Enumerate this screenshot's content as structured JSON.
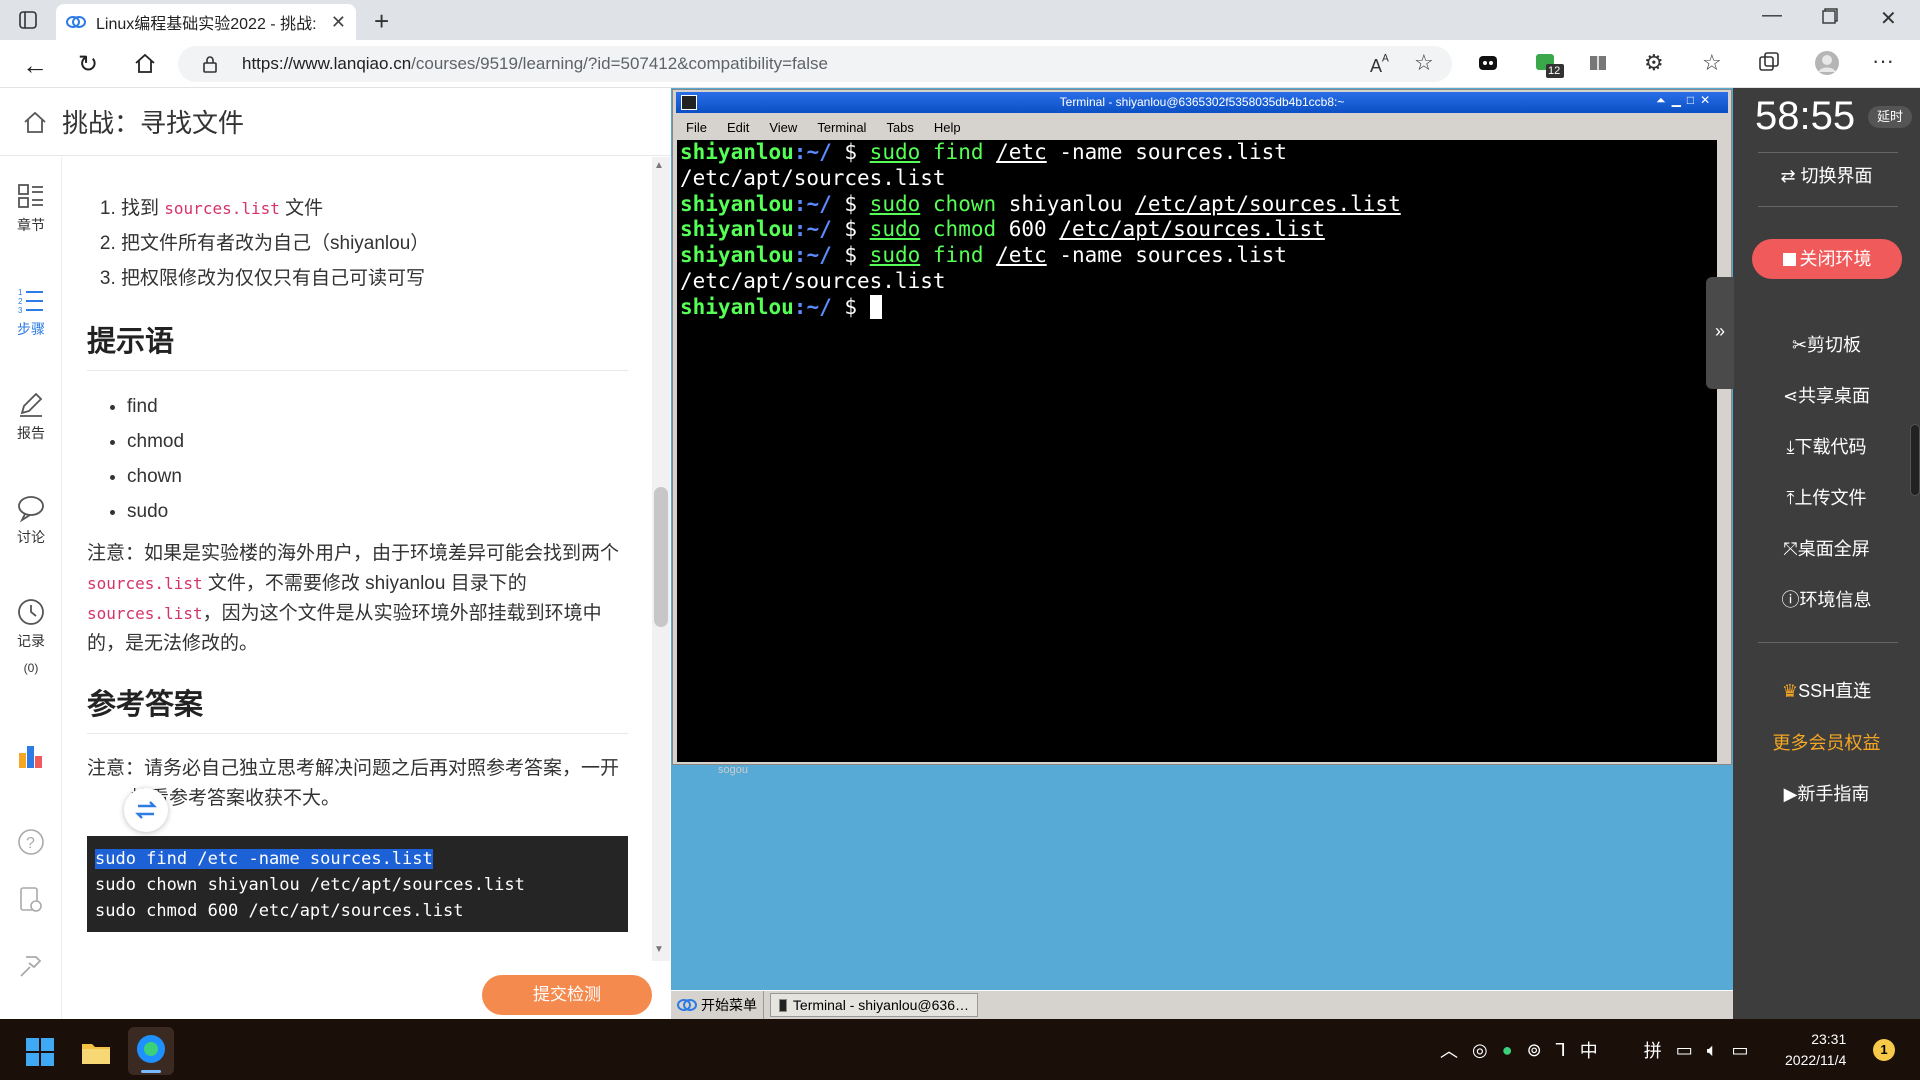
{
  "browser": {
    "tab_title": "Linux编程基础实验2022 - 挑战:",
    "url_main": "https://www.lanqiao.cn",
    "url_rest": "/courses/9519/learning/?id=507412&compatibility=false",
    "badge_count": "12"
  },
  "lesson": {
    "title": "挑战：寻找文件",
    "nav": [
      {
        "label": "章节"
      },
      {
        "label": "步骤"
      },
      {
        "label": "报告"
      },
      {
        "label": "讨论"
      },
      {
        "label": "记录",
        "count": "(0)"
      }
    ],
    "steps": [
      {
        "pre": "找到 ",
        "code": "sources.list",
        "post": " 文件"
      },
      {
        "pre": "把文件所有者改为自己（shiyanlou）",
        "code": "",
        "post": ""
      },
      {
        "pre": "把权限修改为仅仅只有自己可读可写",
        "code": "",
        "post": ""
      }
    ],
    "hint_heading": "提示语",
    "hints": [
      "find",
      "chmod",
      "chown",
      "sudo"
    ],
    "note1": {
      "p1": "注意：如果是实验楼的海外用户，由于环境差异可能会找到两个 ",
      "code1": "sources.list",
      "p2": " 文件，不需要修改 shiyanlou 目录下的 ",
      "code2": "sources.list",
      "p3": "，因为这个文件是从实验环境外部挂载到环境中的，是无法修改的。"
    },
    "answer_heading": "参考答案",
    "note2_a": "注意：请务必自己独立思考解决问题之后再对照参考答案，一开",
    "note2_b": "接看参考答案收获不大。",
    "code_lines": [
      "sudo find /etc -name sources.list",
      "sudo chown shiyanlou /etc/apt/sources.list",
      "sudo chmod 600 /etc/apt/sources.list"
    ],
    "submit_label": "提交检测"
  },
  "terminal": {
    "title": "Terminal - shiyanlou@6365302f5358035db4b1ccb8:~",
    "menu": [
      "File",
      "Edit",
      "View",
      "Terminal",
      "Tabs",
      "Help"
    ],
    "user": "shiyanlou",
    "path": ":~/",
    "dollar": " $ ",
    "lines": [
      {
        "type": "cmd",
        "parts": [
          [
            "cg",
            "sudo"
          ],
          [
            "t",
            " "
          ],
          [
            "cy",
            "find"
          ],
          [
            "t",
            " "
          ],
          [
            "ul",
            "/etc"
          ],
          [
            "t",
            " -name sources.list"
          ]
        ]
      },
      {
        "type": "out",
        "text": "/etc/apt/sources.list"
      },
      {
        "type": "cmd",
        "parts": [
          [
            "cg",
            "sudo"
          ],
          [
            "t",
            " "
          ],
          [
            "cy",
            "chown"
          ],
          [
            "t",
            " shiyanlou "
          ],
          [
            "ul",
            "/etc/apt/sources.list"
          ]
        ]
      },
      {
        "type": "cmd",
        "parts": [
          [
            "cg",
            "sudo"
          ],
          [
            "t",
            " "
          ],
          [
            "cy",
            "chmod"
          ],
          [
            "t",
            " 600 "
          ],
          [
            "ul",
            "/etc/apt/sources.list"
          ]
        ]
      },
      {
        "type": "cmd",
        "parts": [
          [
            "cg",
            "sudo"
          ],
          [
            "t",
            " "
          ],
          [
            "cy",
            "find"
          ],
          [
            "t",
            " "
          ],
          [
            "ul",
            "/etc"
          ],
          [
            "t",
            " -name sources.list"
          ]
        ]
      },
      {
        "type": "out",
        "text": "/etc/apt/sources.list"
      },
      {
        "type": "prompt",
        "parts": []
      }
    ],
    "bg_fragment": "sogou"
  },
  "remote_taskbar": {
    "start": "开始菜单",
    "task": "Terminal - shiyanlou@636…"
  },
  "control": {
    "timer": "58:55",
    "delay": "延时",
    "switch": "⇄ 切换界面",
    "close_env": "关闭环境",
    "clipboard": "剪切板",
    "share": "共享桌面",
    "download": "下载代码",
    "upload": "上传文件",
    "fullscreen": "桌面全屏",
    "envinfo": "环境信息",
    "ssh": "SSH直连",
    "more": "更多会员权益",
    "guide": "新手指南",
    "accent": "#f15a5a",
    "more_color": "#f5a623"
  },
  "system": {
    "time": "23:31",
    "date": "2022/11/4",
    "ime_zh": "中",
    "ime_py": "拼",
    "notif": "1"
  }
}
